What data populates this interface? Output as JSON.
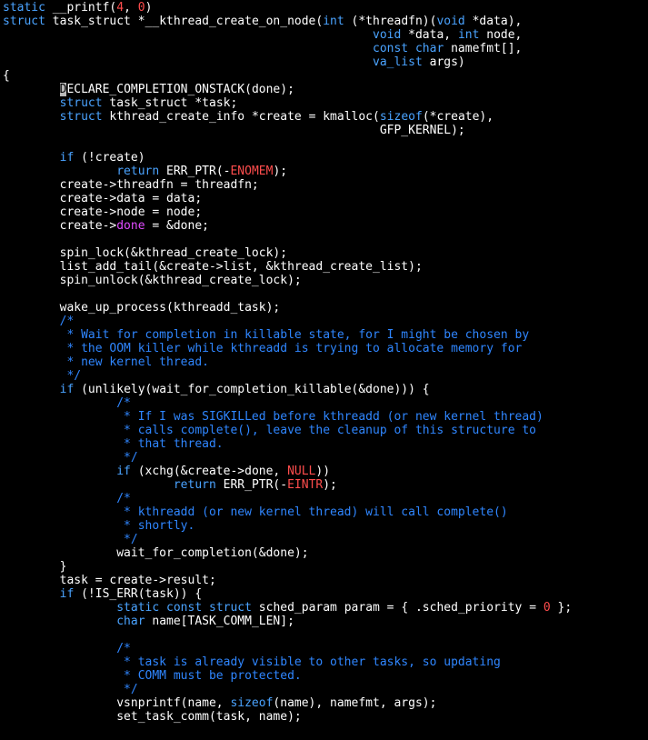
{
  "code_lines": [
    [
      {
        "t": "static",
        "k": "kw"
      },
      {
        "t": " __printf(",
        "k": "plain"
      },
      {
        "t": "4",
        "k": "num"
      },
      {
        "t": ", ",
        "k": "plain"
      },
      {
        "t": "0",
        "k": "num"
      },
      {
        "t": ")",
        "k": "plain"
      }
    ],
    [
      {
        "t": "struct",
        "k": "kw"
      },
      {
        "t": " task_struct *__kthread_create_on_node(",
        "k": "plain"
      },
      {
        "t": "int",
        "k": "type"
      },
      {
        "t": " (*threadfn)(",
        "k": "plain"
      },
      {
        "t": "void",
        "k": "type"
      },
      {
        "t": " *data),",
        "k": "plain"
      }
    ],
    [
      {
        "t": "                                                    ",
        "k": "plain"
      },
      {
        "t": "void",
        "k": "type"
      },
      {
        "t": " *data, ",
        "k": "plain"
      },
      {
        "t": "int",
        "k": "type"
      },
      {
        "t": " node,",
        "k": "plain"
      }
    ],
    [
      {
        "t": "                                                    ",
        "k": "plain"
      },
      {
        "t": "const",
        "k": "kw"
      },
      {
        "t": " ",
        "k": "plain"
      },
      {
        "t": "char",
        "k": "type"
      },
      {
        "t": " namefmt[],",
        "k": "plain"
      }
    ],
    [
      {
        "t": "                                                    ",
        "k": "plain"
      },
      {
        "t": "va_list",
        "k": "type"
      },
      {
        "t": " args)",
        "k": "plain"
      }
    ],
    [
      {
        "t": "{",
        "k": "plain"
      }
    ],
    [
      {
        "t": "        ",
        "k": "plain"
      },
      {
        "t": "D",
        "k": "cursor"
      },
      {
        "t": "ECLARE_COMPLETION_ONSTACK(done);",
        "k": "plain"
      }
    ],
    [
      {
        "t": "        ",
        "k": "plain"
      },
      {
        "t": "struct",
        "k": "kw"
      },
      {
        "t": " task_struct *task;",
        "k": "plain"
      }
    ],
    [
      {
        "t": "        ",
        "k": "plain"
      },
      {
        "t": "struct",
        "k": "kw"
      },
      {
        "t": " kthread_create_info *create = kmalloc(",
        "k": "plain"
      },
      {
        "t": "sizeof",
        "k": "kw"
      },
      {
        "t": "(*create),",
        "k": "plain"
      }
    ],
    [
      {
        "t": "                                                     GFP_KERNEL);",
        "k": "plain"
      }
    ],
    [
      {
        "t": "",
        "k": "plain"
      }
    ],
    [
      {
        "t": "        ",
        "k": "plain"
      },
      {
        "t": "if",
        "k": "kw"
      },
      {
        "t": " (!create)",
        "k": "plain"
      }
    ],
    [
      {
        "t": "                ",
        "k": "plain"
      },
      {
        "t": "return",
        "k": "kw"
      },
      {
        "t": " ERR_PTR(-",
        "k": "plain"
      },
      {
        "t": "ENOMEM",
        "k": "const"
      },
      {
        "t": ");",
        "k": "plain"
      }
    ],
    [
      {
        "t": "        create->threadfn = threadfn;",
        "k": "plain"
      }
    ],
    [
      {
        "t": "        create->data = data;",
        "k": "plain"
      }
    ],
    [
      {
        "t": "        create->node = node;",
        "k": "plain"
      }
    ],
    [
      {
        "t": "        create->",
        "k": "plain"
      },
      {
        "t": "done",
        "k": "mem"
      },
      {
        "t": " = &done;",
        "k": "plain"
      }
    ],
    [
      {
        "t": "",
        "k": "plain"
      }
    ],
    [
      {
        "t": "        spin_lock(&kthread_create_lock);",
        "k": "plain"
      }
    ],
    [
      {
        "t": "        list_add_tail(&create->list, &kthread_create_list);",
        "k": "plain"
      }
    ],
    [
      {
        "t": "        spin_unlock(&kthread_create_lock);",
        "k": "plain"
      }
    ],
    [
      {
        "t": "",
        "k": "plain"
      }
    ],
    [
      {
        "t": "        wake_up_process(kthreadd_task);",
        "k": "plain"
      }
    ],
    [
      {
        "t": "        /*",
        "k": "cmt"
      }
    ],
    [
      {
        "t": "         * Wait for completion in killable state, for I might be chosen by",
        "k": "cmt"
      }
    ],
    [
      {
        "t": "         * the OOM killer while kthreadd is trying to allocate memory for",
        "k": "cmt"
      }
    ],
    [
      {
        "t": "         * new kernel thread.",
        "k": "cmt"
      }
    ],
    [
      {
        "t": "         */",
        "k": "cmt"
      }
    ],
    [
      {
        "t": "        ",
        "k": "plain"
      },
      {
        "t": "if",
        "k": "kw"
      },
      {
        "t": " (unlikely(wait_for_completion_killable(&done))) {",
        "k": "plain"
      }
    ],
    [
      {
        "t": "                /*",
        "k": "cmt"
      }
    ],
    [
      {
        "t": "                 * If I was SIGKILLed before kthreadd (or new kernel thread)",
        "k": "cmt"
      }
    ],
    [
      {
        "t": "                 * calls complete(), leave the cleanup of this structure to",
        "k": "cmt"
      }
    ],
    [
      {
        "t": "                 * that thread.",
        "k": "cmt"
      }
    ],
    [
      {
        "t": "                 */",
        "k": "cmt"
      }
    ],
    [
      {
        "t": "                ",
        "k": "plain"
      },
      {
        "t": "if",
        "k": "kw"
      },
      {
        "t": " (xchg(&create->done, ",
        "k": "plain"
      },
      {
        "t": "NULL",
        "k": "const"
      },
      {
        "t": "))",
        "k": "plain"
      }
    ],
    [
      {
        "t": "                        ",
        "k": "plain"
      },
      {
        "t": "return",
        "k": "kw"
      },
      {
        "t": " ERR_PTR(-",
        "k": "plain"
      },
      {
        "t": "EINTR",
        "k": "const"
      },
      {
        "t": ");",
        "k": "plain"
      }
    ],
    [
      {
        "t": "                /*",
        "k": "cmt"
      }
    ],
    [
      {
        "t": "                 * kthreadd (or new kernel thread) will call complete()",
        "k": "cmt"
      }
    ],
    [
      {
        "t": "                 * shortly.",
        "k": "cmt"
      }
    ],
    [
      {
        "t": "                 */",
        "k": "cmt"
      }
    ],
    [
      {
        "t": "                wait_for_completion(&done);",
        "k": "plain"
      }
    ],
    [
      {
        "t": "        }",
        "k": "plain"
      }
    ],
    [
      {
        "t": "        task = create->result;",
        "k": "plain"
      }
    ],
    [
      {
        "t": "        ",
        "k": "plain"
      },
      {
        "t": "if",
        "k": "kw"
      },
      {
        "t": " (!IS_ERR(task)) {",
        "k": "plain"
      }
    ],
    [
      {
        "t": "                ",
        "k": "plain"
      },
      {
        "t": "static",
        "k": "kw"
      },
      {
        "t": " ",
        "k": "plain"
      },
      {
        "t": "const",
        "k": "kw"
      },
      {
        "t": " ",
        "k": "plain"
      },
      {
        "t": "struct",
        "k": "kw"
      },
      {
        "t": " sched_param param = { .sched_priority = ",
        "k": "plain"
      },
      {
        "t": "0",
        "k": "num"
      },
      {
        "t": " };",
        "k": "plain"
      }
    ],
    [
      {
        "t": "                ",
        "k": "plain"
      },
      {
        "t": "char",
        "k": "type"
      },
      {
        "t": " name[TASK_COMM_LEN];",
        "k": "plain"
      }
    ],
    [
      {
        "t": "",
        "k": "plain"
      }
    ],
    [
      {
        "t": "                /*",
        "k": "cmt"
      }
    ],
    [
      {
        "t": "                 * task is already visible to other tasks, so updating",
        "k": "cmt"
      }
    ],
    [
      {
        "t": "                 * COMM must be protected.",
        "k": "cmt"
      }
    ],
    [
      {
        "t": "                 */",
        "k": "cmt"
      }
    ],
    [
      {
        "t": "                vsnprintf(name, ",
        "k": "plain"
      },
      {
        "t": "sizeof",
        "k": "kw"
      },
      {
        "t": "(name), namefmt, args);",
        "k": "plain"
      }
    ],
    [
      {
        "t": "                set_task_comm(task, name);",
        "k": "plain"
      }
    ]
  ],
  "colors": {
    "background": "#000000",
    "text": "#ffffff",
    "keyword": "#4aa3ff",
    "type": "#4aa3ff",
    "number": "#ff4d4d",
    "constant": "#ff4d4d",
    "member": "#e04cff",
    "comment": "#2f86ff",
    "cursor": "#b8b8b8"
  }
}
